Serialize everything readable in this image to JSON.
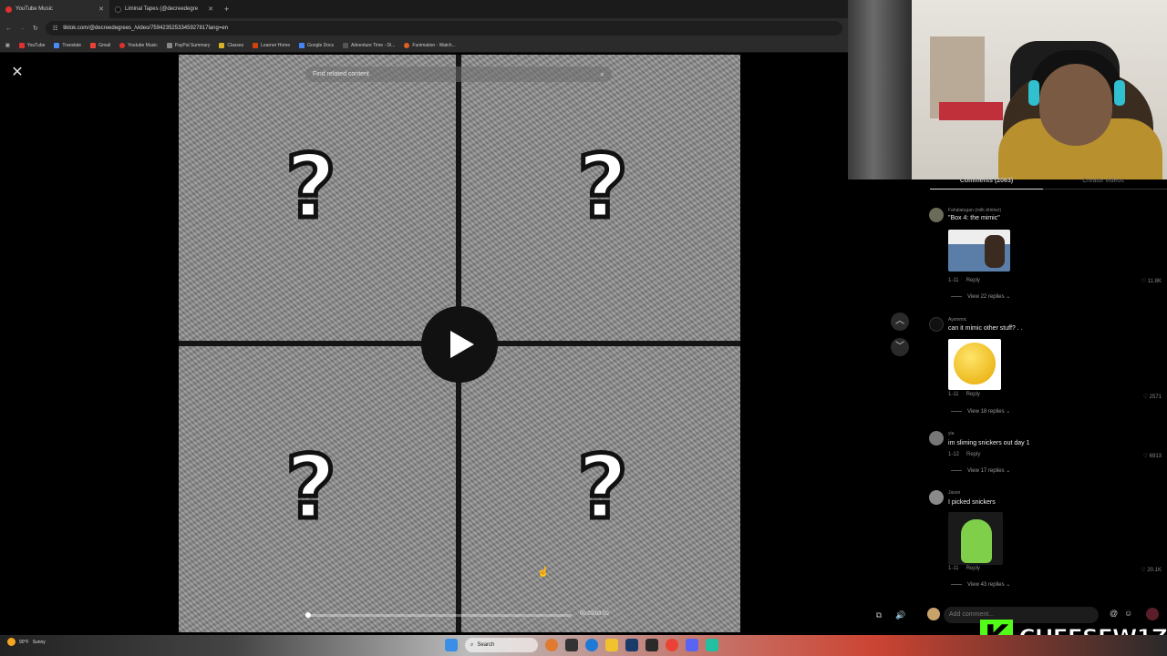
{
  "browser": {
    "tabs": [
      {
        "title": "YouTube Music",
        "active": true
      },
      {
        "title": "Liminal Tapes (@decreedegre",
        "active": false
      }
    ],
    "url": "tiktok.com/@decreedegrees_/video/7594235253345927817lang=en",
    "bookmarks": [
      "YouTube",
      "Translate",
      "Gmail",
      "Youtube Music",
      "PayPal Summary",
      "Classes",
      "Learner Home",
      "Google Docs",
      "Adventure Time - Di...",
      "Funimation - Watch..."
    ]
  },
  "video": {
    "search_placeholder": "Find related content",
    "quadrant_symbol": "?",
    "timecode": "00:03/03:00",
    "progress": 0.01
  },
  "comments_panel": {
    "tab_comments": "Comments (2063)",
    "tab_creator": "Creator videos",
    "comments": [
      {
        "user": "Fahalatugan (milk drinker)",
        "text": "\"Box 4: the mimic\"",
        "date": "1-11",
        "reply": "Reply",
        "likes": "11.8K",
        "replies": "View 22 replies",
        "image": "meme-photo"
      },
      {
        "user": "Aysmmic",
        "text": "can it mimic other stuff? . .",
        "date": "1-11",
        "reply": "Reply",
        "likes": "2571",
        "replies": "View 18 replies",
        "image": "emoji-thinking"
      },
      {
        "user": "yia",
        "text": "im sliming snickers out day 1",
        "date": "1-12",
        "reply": "Reply",
        "likes": "6913",
        "replies": "View 17 replies"
      },
      {
        "user": "Jason",
        "text": "I picked snickers",
        "date": "1-11",
        "reply": "Reply",
        "likes": "20.1K",
        "replies": "View 43 replies",
        "image": "green-creature"
      }
    ],
    "add_comment_placeholder": "Add comment..."
  },
  "stream": {
    "brand_letter": "K",
    "brand_name": "CHEESEW1Z"
  },
  "taskbar": {
    "weather": "90°F",
    "weather_sub": "Sunny",
    "search_label": "Search"
  }
}
